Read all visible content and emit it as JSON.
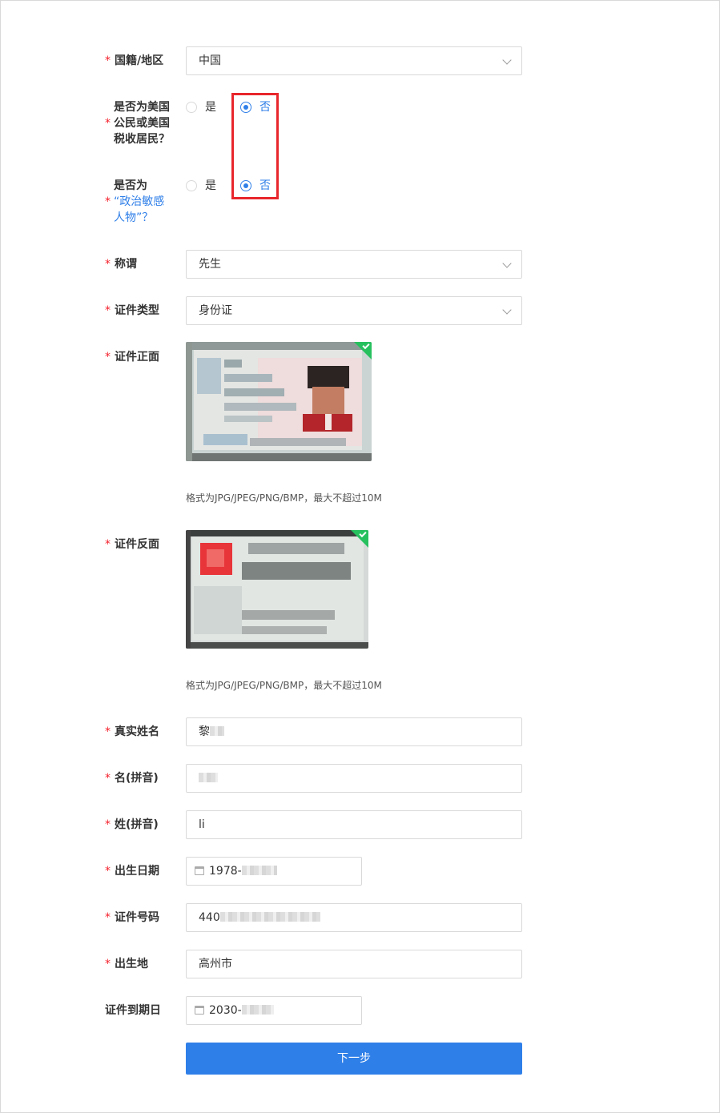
{
  "form": {
    "nationality": {
      "label": "国籍/地区",
      "value": "中国"
    },
    "us_tax": {
      "label_lines": [
        "是否为美国",
        "公民或美国",
        "税收居民？"
      ],
      "options": [
        {
          "label": "是",
          "selected": false
        },
        {
          "label": "否",
          "selected": true
        }
      ]
    },
    "pep": {
      "label_line1": "是否为",
      "label_link_line2": "“政治敏感",
      "label_link_line3": "人物”？",
      "options": [
        {
          "label": "是",
          "selected": false
        },
        {
          "label": "否",
          "selected": true
        }
      ]
    },
    "title": {
      "label": "称谓",
      "value": "先生"
    },
    "id_type": {
      "label": "证件类型",
      "value": "身份证"
    },
    "id_front": {
      "label": "证件正面",
      "hint": "格式为JPG/JPEG/PNG/BMP，最大不超过10M"
    },
    "id_back": {
      "label": "证件反面",
      "hint": "格式为JPG/JPEG/PNG/BMP，最大不超过10M"
    },
    "real_name": {
      "label": "真实姓名",
      "value": "黎"
    },
    "given_name_pinyin": {
      "label": "名(拼音)",
      "value": ""
    },
    "surname_pinyin": {
      "label": "姓(拼音)",
      "value": "li"
    },
    "birth_date": {
      "label": "出生日期",
      "value": "1978-"
    },
    "id_number": {
      "label": "证件号码",
      "value": "440"
    },
    "birth_place": {
      "label": "出生地",
      "value": "高州市"
    },
    "id_expiry": {
      "label": "证件到期日",
      "value": "2030-"
    },
    "next_button": "下一步"
  },
  "colors": {
    "accent": "#2f7fe8",
    "required": "#f5222d",
    "highlight": "#e8262c",
    "upload_ok": "#27c05f"
  }
}
